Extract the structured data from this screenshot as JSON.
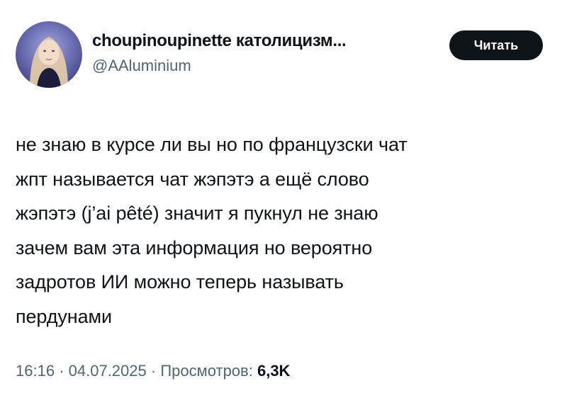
{
  "tweet": {
    "author": {
      "display_name": "choupinoupinette католицизм...",
      "handle": "@AAluminium"
    },
    "follow_button": "Читать",
    "lines": [
      "не знаю в курсе ли вы но по французски чат",
      "жпт называется чат жэпэтэ а ещё слово",
      "жэпэтэ (j’ai pêté) значит я пукнул не знаю",
      "зачем вам эта информация но вероятно",
      "задротов ИИ можно теперь называть",
      "пердунами"
    ],
    "time": "16:16",
    "separator": "·",
    "date": "04.07.2025",
    "views_label": "Просмотров:",
    "views_count": "6,3K"
  },
  "colors": {
    "text": "#0f1419",
    "secondary": "#536471",
    "button_bg": "#0f1419",
    "button_text": "#ffffff"
  }
}
